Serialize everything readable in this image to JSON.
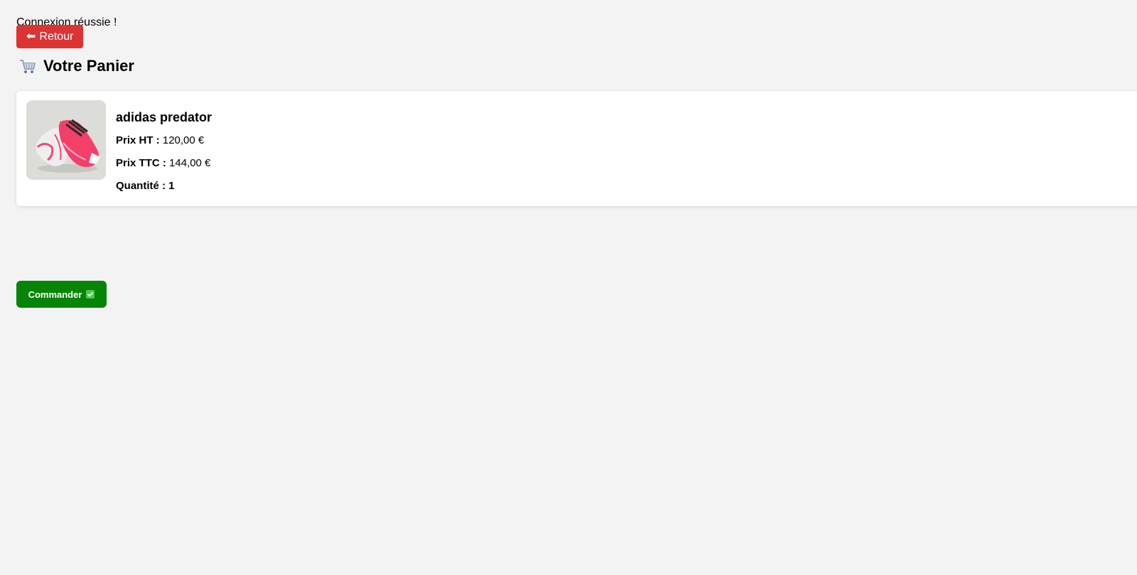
{
  "flash": {
    "message": "Connexion réussie !"
  },
  "back_button": {
    "label": "Retour",
    "icon": "left-arrow-icon",
    "color": "#dc3333"
  },
  "header": {
    "title": "Votre Panier",
    "icon": "shopping-cart-icon"
  },
  "cart": {
    "items": [
      {
        "name": "adidas predator",
        "price_ht_label": "Prix HT :",
        "price_ht_value": "120,00 €",
        "price_ttc_label": "Prix TTC :",
        "price_ttc_value": "144,00 €",
        "quantity_label": "Quantité : 1",
        "image": "pink-football-boots-image"
      }
    ]
  },
  "order_button": {
    "label": "Commander",
    "icon": "check-box-icon",
    "color": "#058405"
  }
}
